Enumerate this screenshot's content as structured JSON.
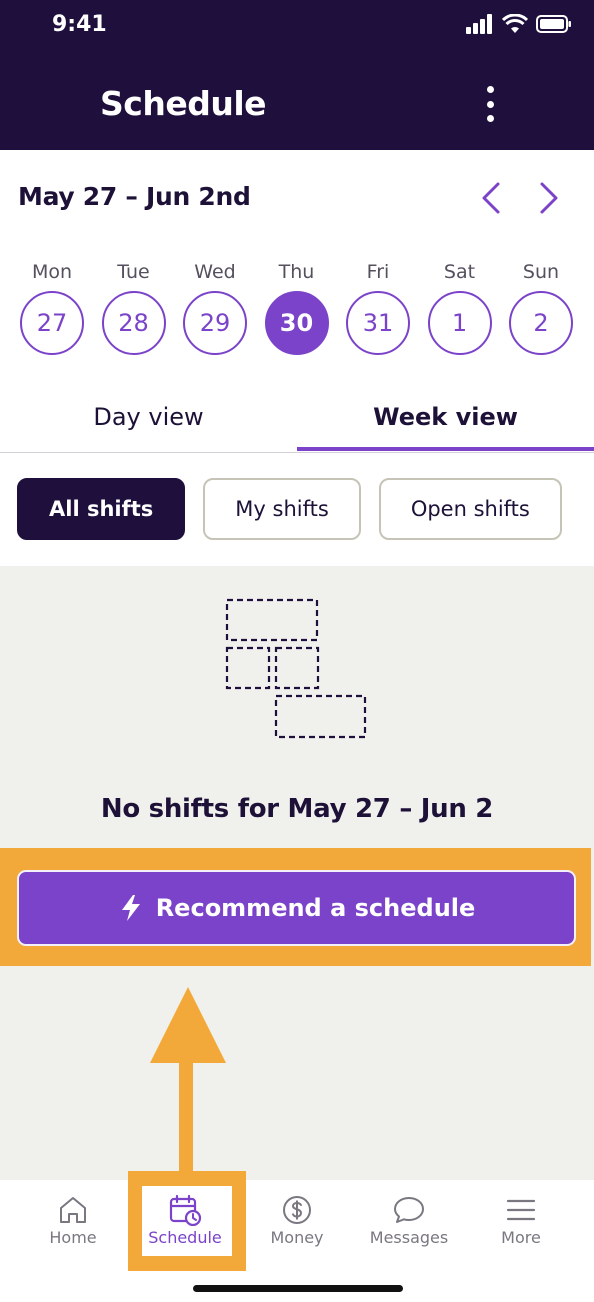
{
  "status_bar": {
    "time": "9:41"
  },
  "header": {
    "title": "Schedule",
    "menu_icon": "more-vertical-icon"
  },
  "week": {
    "range_label": "May 27 – Jun 2nd",
    "days": [
      {
        "name": "Mon",
        "num": "27"
      },
      {
        "name": "Tue",
        "num": "28"
      },
      {
        "name": "Wed",
        "num": "29"
      },
      {
        "name": "Thu",
        "num": "30"
      },
      {
        "name": "Fri",
        "num": "31"
      },
      {
        "name": "Sat",
        "num": "1"
      },
      {
        "name": "Sun",
        "num": "2"
      }
    ],
    "selected_day": "30"
  },
  "tabs": {
    "day": "Day view",
    "week": "Week view",
    "active": "week"
  },
  "filters": {
    "all": "All shifts",
    "mine": "My shifts",
    "open": "Open shifts",
    "active": "all"
  },
  "empty_state": {
    "message": "No shifts for May 27 – Jun 2"
  },
  "recommend_button": {
    "label": "Recommend a schedule",
    "icon": "lightning-icon"
  },
  "bottom_nav": {
    "home": "Home",
    "schedule": "Schedule",
    "money": "Money",
    "messages": "Messages",
    "more": "More",
    "active": "schedule"
  },
  "colors": {
    "header_bg": "#1e0f3c",
    "accent": "#7b43c9",
    "highlight": "#f3a93a",
    "content_bg": "#f0f0ec"
  }
}
